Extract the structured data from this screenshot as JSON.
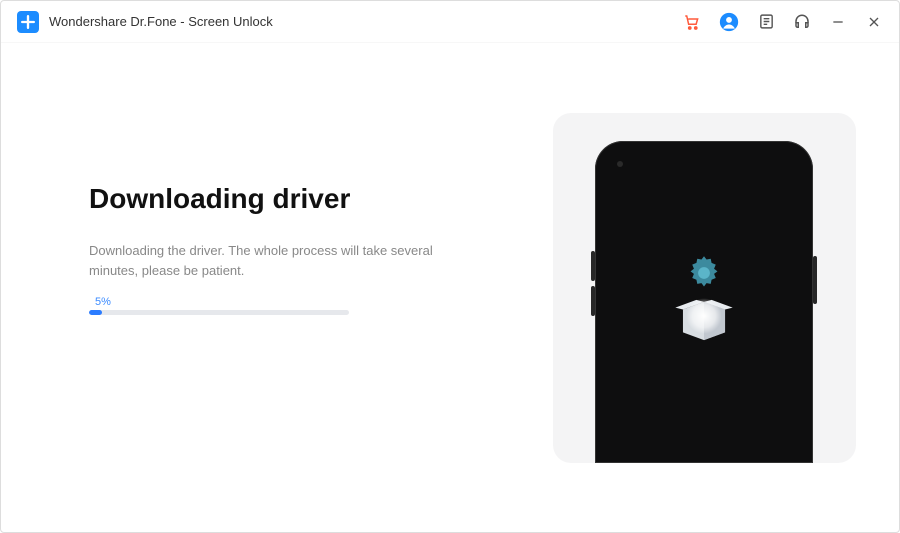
{
  "window": {
    "title": "Wondershare Dr.Fone - Screen Unlock"
  },
  "main": {
    "heading": "Downloading driver",
    "subtext": "Downloading the driver. The whole process will take several minutes, please be patient.",
    "progress_percent_label": "5%",
    "progress_value": 5
  },
  "colors": {
    "accent": "#2b7cff"
  }
}
